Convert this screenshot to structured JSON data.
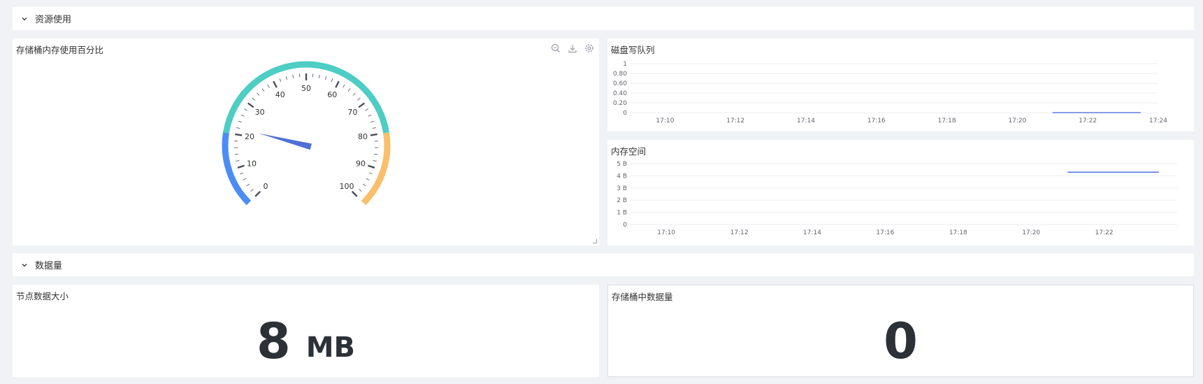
{
  "sections": {
    "resource": {
      "title": "资源使用"
    },
    "data": {
      "title": "数据量"
    }
  },
  "gauge_panel": {
    "title": "存储桶内存使用百分比",
    "tools": [
      "zoom-icon",
      "download-icon",
      "settings-icon"
    ]
  },
  "disk_panel": {
    "title": "磁盘写队列"
  },
  "memory_panel": {
    "title": "内存空间"
  },
  "node_size_panel": {
    "title": "节点数据大小",
    "value": "8",
    "unit": "MB"
  },
  "bucket_count_panel": {
    "title": "存储桶中数据量",
    "value": "0"
  },
  "colors": {
    "teal": "#4ecdc4",
    "blue": "#4c8cf5",
    "orange": "#fbbe6a",
    "needle": "#4e6fd6",
    "line": "#5b7be0"
  },
  "chart_data": [
    {
      "type": "gauge",
      "title": "存储桶内存使用百分比",
      "min": 0,
      "max": 100,
      "value": 22,
      "major_ticks": [
        0,
        10,
        20,
        30,
        40,
        50,
        60,
        70,
        80,
        90,
        100
      ],
      "bands": [
        {
          "from": 0,
          "to": 20,
          "color": "#4c8cf5"
        },
        {
          "from": 20,
          "to": 80,
          "color": "#4ecdc4"
        },
        {
          "from": 80,
          "to": 100,
          "color": "#fbbe6a"
        }
      ]
    },
    {
      "type": "line",
      "title": "磁盘写队列",
      "x_ticks": [
        "17:10",
        "17:12",
        "17:14",
        "17:16",
        "17:18",
        "17:20",
        "17:22",
        "17:24"
      ],
      "y_ticks": [
        "0",
        "0.20",
        "0.40",
        "0.60",
        "0.80",
        "1"
      ],
      "ylim": [
        0,
        1
      ],
      "xlim_minutes": [
        9,
        24
      ],
      "series": [
        {
          "x": [
            "17:21",
            "17:23.5"
          ],
          "values": [
            0,
            0
          ]
        }
      ]
    },
    {
      "type": "line",
      "title": "内存空间",
      "x_ticks": [
        "17:10",
        "17:12",
        "17:14",
        "17:16",
        "17:18",
        "17:20",
        "17:22"
      ],
      "y_ticks": [
        "0",
        "1 B",
        "2 B",
        "3 B",
        "4 B",
        "5 B"
      ],
      "ylim": [
        0,
        5
      ],
      "xlim_minutes": [
        9,
        24
      ],
      "series": [
        {
          "x": [
            "17:21",
            "17:23.5"
          ],
          "values": [
            4.3,
            4.3
          ]
        }
      ]
    }
  ]
}
